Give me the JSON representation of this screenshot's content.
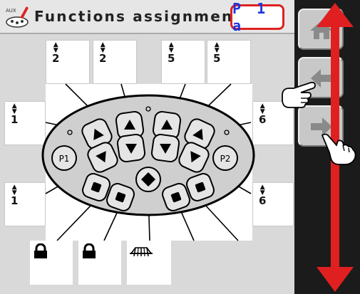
{
  "header": {
    "title": "Functions assignment",
    "page_indicator": "P 1 a",
    "logo_text": "AUX"
  },
  "slots": {
    "top": [
      "2",
      "2",
      "5",
      "5"
    ],
    "left": [
      "1",
      "1"
    ],
    "right": [
      "6",
      "6"
    ]
  },
  "joystick": {
    "left_circle_label": "P1",
    "right_circle_label": "P2"
  },
  "bottom_slots": [
    "lock-icon",
    "lock-icon",
    "harrow-icon"
  ],
  "sidebar": {
    "buttons": [
      "home-icon",
      "arrow-left-icon",
      "arrow-right-icon"
    ]
  },
  "colors": {
    "accent_red": "#e02020",
    "page_indicator_text": "#1b35e0",
    "background": "#d9d9d9",
    "sidebar_background": "#1b1b1b"
  }
}
